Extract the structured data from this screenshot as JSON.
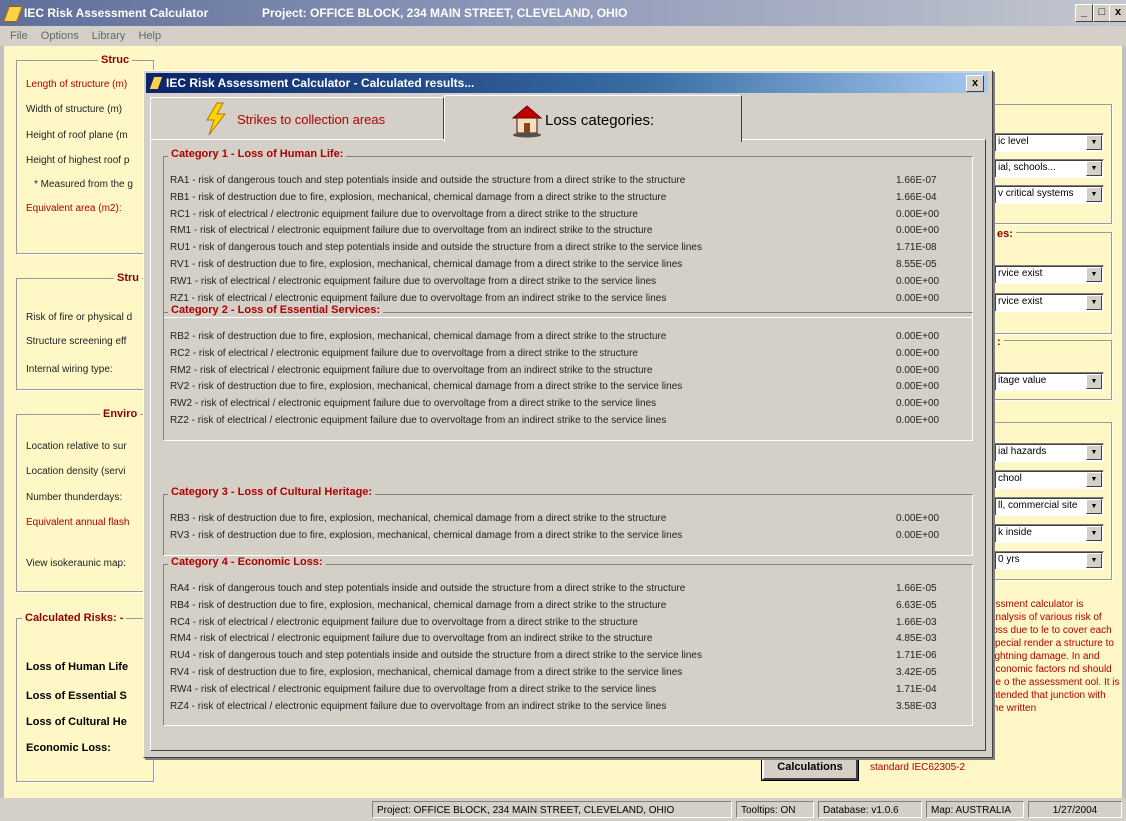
{
  "window": {
    "app_title": "IEC Risk Assessment Calculator",
    "project_title": "Project: OFFICE BLOCK, 234 MAIN STREET, CLEVELAND, OHIO",
    "min": "_",
    "max": "̸",
    "close": "x"
  },
  "menu": [
    "File",
    "Options",
    "Library",
    "Help"
  ],
  "left_panel": {
    "structure_title": "Struc",
    "structure_labels": [
      "Length of structure (m)",
      "Width of structure (m)",
      "Height of roof plane (m",
      "Height of highest roof p",
      "* Measured from the g",
      "Equivalent area (m2):"
    ],
    "strength_title": "Stru",
    "strength_labels": [
      "Risk of fire or physical d",
      "Structure screening eff",
      "Internal wiring type:"
    ],
    "environment_title": "Enviro",
    "environment_labels": [
      "Location relative to sur",
      "Location density (servi",
      "Number thunderdays:",
      "Equivalent annual flash",
      "View isokeraunic map:"
    ],
    "calc_title": "Calculated Risks: -",
    "calc_labels": [
      "Loss of Human Life",
      "Loss of Essential S",
      "Loss of Cultural He",
      "Economic Loss:"
    ]
  },
  "right_panel": {
    "combos": [
      "ic level",
      "ial, schools...",
      "v critical systems",
      "rvice exist",
      "rvice exist",
      "itage value",
      "ial hazards",
      "chool",
      "ll, commercial site",
      "k inside",
      "0 yrs"
    ],
    "sub_titles": [
      "es:",
      ":"
    ],
    "note": "essment calculator is analysis of various risk of loss due to le to cover each special render a structure to lightning damage. In and economic factors nd should be o the assessment ool. It is intended that junction with the written"
  },
  "calc_button": "Calculations",
  "standard_link": "standard IEC62305-2",
  "dialog": {
    "title": "IEC Risk Assessment Calculator - Calculated results...",
    "close": "x",
    "tabs": [
      {
        "label": "Strikes to collection areas"
      },
      {
        "label": "Loss categories:"
      }
    ],
    "categories": [
      {
        "title": "Category 1 - Loss of Human Life:",
        "rows": [
          {
            "desc": "RA1 - risk of dangerous touch and step potentials inside and outside the structure from a direct strike to the structure",
            "value": "1.66E-07"
          },
          {
            "desc": "RB1 - risk of destruction due to fire, explosion, mechanical, chemical  damage from a direct strike to the structure",
            "value": "1.66E-04"
          },
          {
            "desc": "RC1 - risk of electrical / electronic equipment failure due to overvoltage from a direct strike to the structure",
            "value": "0.00E+00"
          },
          {
            "desc": "RM1 - risk of electrical / electronic equipment failure due to overvoltage from an indirect strike to the structure",
            "value": "0.00E+00"
          },
          {
            "desc": "RU1 - risk of dangerous touch and step potentials inside and outside the structure from a direct strike to the service lines",
            "value": "1.71E-08"
          },
          {
            "desc": "RV1 - risk of destruction due to fire, explosion, mechanical, chemical  damage from a direct strike to the service lines",
            "value": "8.55E-05"
          },
          {
            "desc": "RW1 - risk of electrical / electronic equipment failure due to overvoltage from a direct strike to the service lines",
            "value": "0.00E+00"
          },
          {
            "desc": "RZ1 - risk of electrical / electronic equipment failure due to overvoltage from an indirect strike to the service lines",
            "value": "0.00E+00"
          }
        ]
      },
      {
        "title": "Category 2 - Loss of Essential Services:",
        "rows": [
          {
            "desc": "RB2 - risk of destruction due to fire, explosion, mechanical, chemical  damage from a direct strike to the structure",
            "value": "0.00E+00"
          },
          {
            "desc": "RC2 - risk of electrical / electronic equipment failure due to overvoltage from a direct strike to the structure",
            "value": "0.00E+00"
          },
          {
            "desc": "RM2 - risk of electrical / electronic equipment failure due to overvoltage from an indirect strike to the structure",
            "value": "0.00E+00"
          },
          {
            "desc": "RV2 - risk of destruction due to fire, explosion, mechanical, chemical  damage from a direct strike to the service lines",
            "value": "0.00E+00"
          },
          {
            "desc": "RW2 - risk of electrical / electronic equipment failure due to overvoltage from a direct strike to the service lines",
            "value": "0.00E+00"
          },
          {
            "desc": "RZ2 - risk of electrical / electronic equipment failure due to overvoltage from an indirect strike to the service lines",
            "value": "0.00E+00"
          }
        ]
      },
      {
        "title": "Category 3 - Loss of Cultural Heritage:",
        "rows": [
          {
            "desc": "RB3 - risk of destruction due to fire, explosion, mechanical, chemical  damage from a direct strike to the structure",
            "value": "0.00E+00"
          },
          {
            "desc": "RV3 - risk of destruction due to fire, explosion, mechanical, chemical  damage from a direct strike to the service lines",
            "value": "0.00E+00"
          }
        ]
      },
      {
        "title": "Category 4 - Economic Loss:",
        "rows": [
          {
            "desc": "RA4 - risk of dangerous touch and step potentials inside and outside the structure from a direct strike to the structure",
            "value": "1.66E-05"
          },
          {
            "desc": "RB4 - risk of destruction due to fire, explosion, mechanical, chemical  damage from a direct strike to the structure",
            "value": "6.63E-05"
          },
          {
            "desc": "RC4 - risk of electrical / electronic equipment failure due to overvoltage from a direct strike to the structure",
            "value": "1.66E-03"
          },
          {
            "desc": "RM4 - risk of electrical / electronic equipment failure due to overvoltage from an indirect strike to the structure",
            "value": "4.85E-03"
          },
          {
            "desc": "RU4 - risk of dangerous touch and step potentials inside and outside the structure from a direct strike to the service lines",
            "value": "1.71E-06"
          },
          {
            "desc": "RV4 - risk of destruction due to fire, explosion, mechanical, chemical  damage from a direct strike to the service lines",
            "value": "3.42E-05"
          },
          {
            "desc": "RW4 - risk of electrical / electronic equipment failure due to overvoltage from a direct strike to the service lines",
            "value": "1.71E-04"
          },
          {
            "desc": "RZ4 - risk of electrical / electronic equipment failure due to overvoltage from an indirect strike to the service lines",
            "value": "3.58E-03"
          }
        ]
      }
    ]
  },
  "statusbar": {
    "project": "Project: OFFICE BLOCK, 234 MAIN STREET, CLEVELAND, OHIO",
    "tooltips": "Tooltips: ON",
    "database": "Database: v1.0.6",
    "map": "Map: AUSTRALIA",
    "date": "1/27/2004"
  },
  "colors": {
    "accent_red": "#b00000",
    "panel_bg": "#fff7c6",
    "dialog_bg": "#d4d0c8"
  },
  "icons": {
    "strikes_tab": "lightning-icon",
    "loss_tab": "house-icon"
  }
}
